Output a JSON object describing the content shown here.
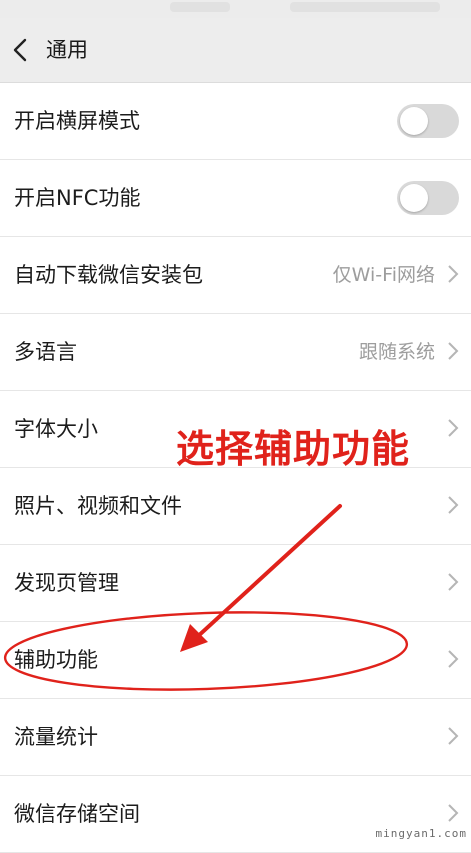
{
  "header": {
    "title": "通用"
  },
  "settings": [
    {
      "label": "开启横屏模式",
      "value": "",
      "control": "toggle",
      "toggle_on": false
    },
    {
      "label": "开启NFC功能",
      "value": "",
      "control": "toggle",
      "toggle_on": false
    },
    {
      "label": "自动下载微信安装包",
      "value": "仅Wi-Fi网络",
      "control": "chevron"
    },
    {
      "label": "多语言",
      "value": "跟随系统",
      "control": "chevron"
    },
    {
      "label": "字体大小",
      "value": "",
      "control": "chevron"
    },
    {
      "label": "照片、视频和文件",
      "value": "",
      "control": "chevron"
    },
    {
      "label": "发现页管理",
      "value": "",
      "control": "chevron"
    },
    {
      "label": "辅助功能",
      "value": "",
      "control": "chevron"
    },
    {
      "label": "流量统计",
      "value": "",
      "control": "chevron"
    },
    {
      "label": "微信存储空间",
      "value": "",
      "control": "chevron"
    }
  ],
  "annotation": {
    "text": "选择辅助功能",
    "color": "#e0221b"
  },
  "watermark": {
    "text": "mingyan1.com"
  },
  "icons": {
    "back": "chevron-left-icon",
    "row_arrow": "chevron-right-icon"
  }
}
